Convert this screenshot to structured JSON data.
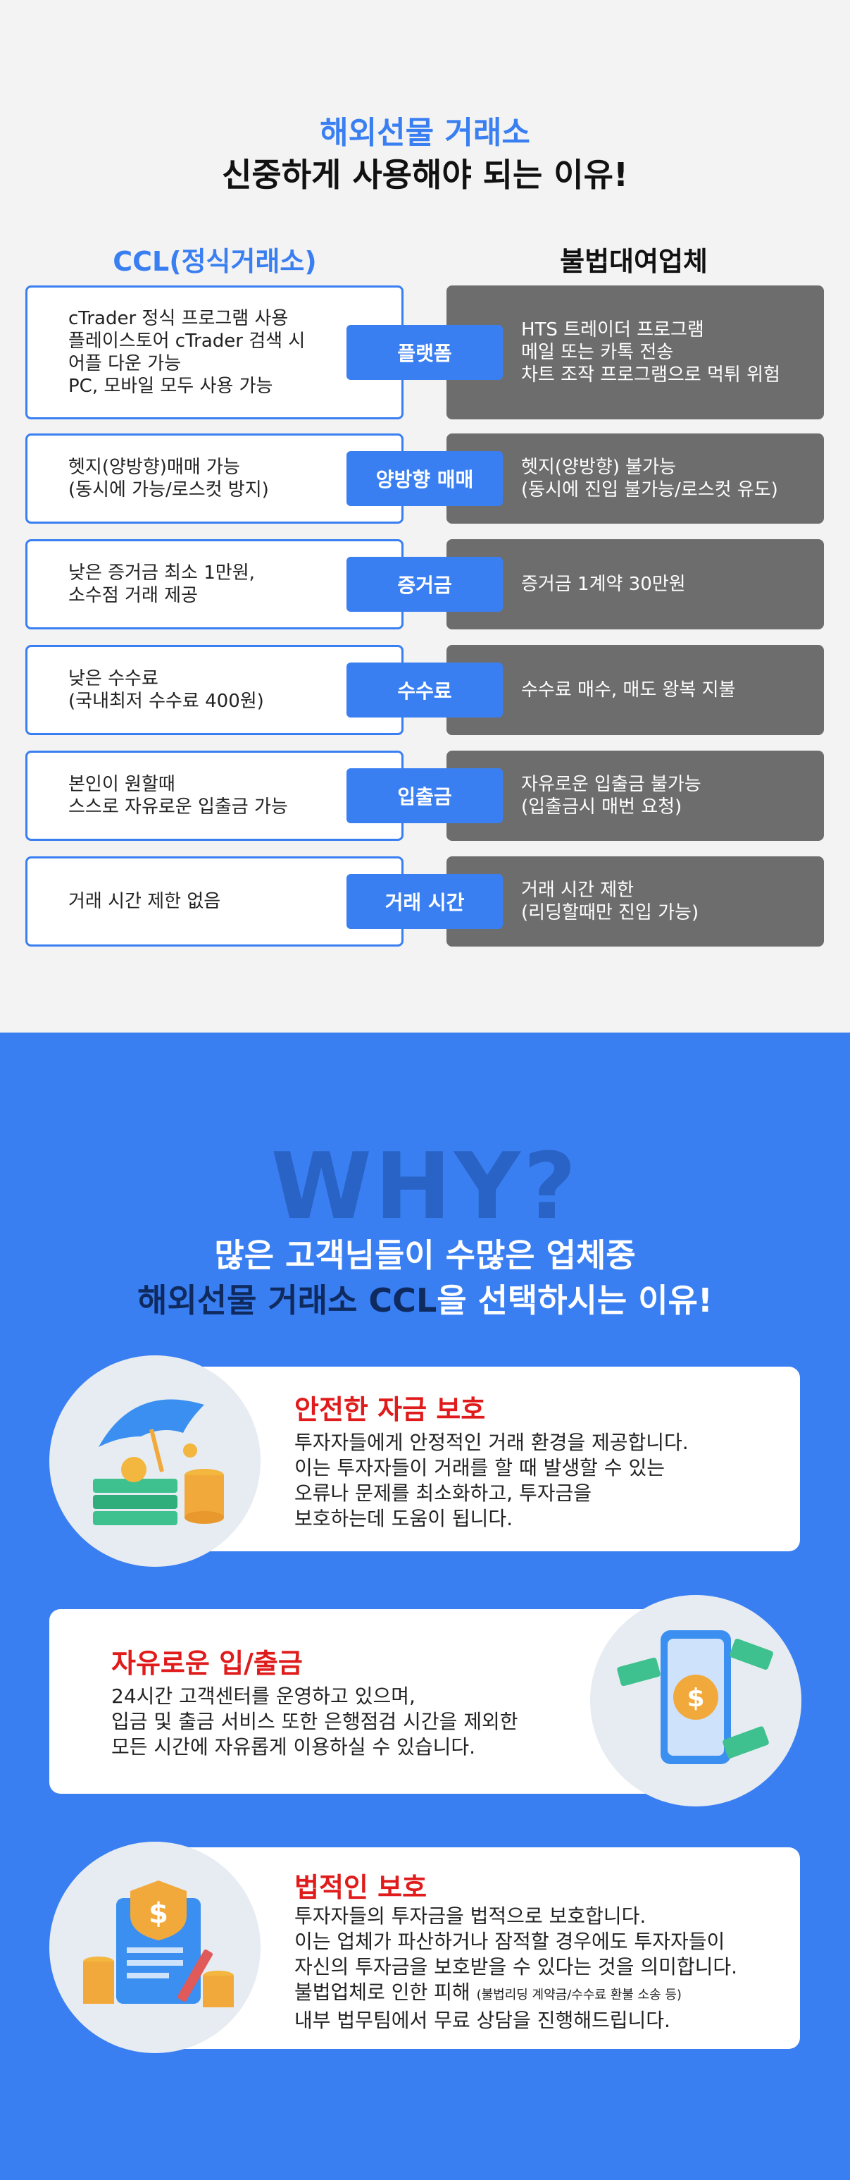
{
  "section1": {
    "title_line1": "해외선물 거래소",
    "title_line2": "신중하게 사용해야 되는 이유!",
    "left_header": "CCL(정식거래소)",
    "right_header": "불법대여업체",
    "rows": [
      {
        "label": "플랫폼",
        "left": "cTrader 정식 프로그램 사용\n플레이스토어 cTrader 검색 시\n어플 다운 가능\nPC, 모바일 모두 사용 가능",
        "right": "HTS 트레이더 프로그램\n메일 또는 카톡 전송\n차트 조작 프로그램으로 먹튀 위험"
      },
      {
        "label": "양방향 매매",
        "left": "헷지(양방향)매매 가능\n(동시에 가능/로스컷 방지)",
        "right": "헷지(양방향) 불가능\n(동시에 진입 불가능/로스컷 유도)"
      },
      {
        "label": "증거금",
        "left": "낮은 증거금 최소 1만원,\n소수점 거래 제공",
        "right": "증거금 1계약 30만원"
      },
      {
        "label": "수수료",
        "left": "낮은 수수료\n(국내최저 수수료 400원)",
        "right": "수수료 매수, 매도 왕복 지불"
      },
      {
        "label": "입출금",
        "left": "본인이 원할때\n스스로 자유로운 입출금 가능",
        "right": "자유로운 입출금 불가능\n(입출금시 매번 요청)"
      },
      {
        "label": "거래 시간",
        "left": "거래 시간 제한 없음",
        "right": "거래 시간 제한\n(리딩할때만 진입 가능)"
      }
    ]
  },
  "section2": {
    "watermark": "WHY?",
    "title_line1": "많은 고객님들이 수많은 업체중",
    "title_line2_accent": "해외선물 거래소 CCL",
    "title_line2_rest": "을 선택하시는 이유!",
    "cards": [
      {
        "title": "안전한 자금 보호",
        "body": "투자자들에게 안정적인 거래 환경을 제공합니다.\n이는 투자자들이 거래를 할 때 발생할 수 있는\n오류나 문제를 최소화하고, 투자금을\n보호하는데 도움이 됩니다.",
        "icon": "umbrella-money-icon"
      },
      {
        "title": "자유로운 입/출금",
        "body": "24시간 고객센터를 운영하고 있으며,\n입금 및 출금 서비스 또한 은행점검 시간을 제외한\n모든 시간에 자유롭게 이용하실 수 있습니다.",
        "icon": "phone-coin-icon"
      },
      {
        "title": "법적인 보호",
        "body_lines": [
          "투자자들의 투자금을 법적으로 보호합니다.",
          "이는 업체가 파산하거나 잠적할 경우에도 투자자들이",
          "자신의 투자금을 보호받을 수 있다는 것을 의미합니다."
        ],
        "body_line4_main": "불법업체로 인한 피해",
        "body_line4_small": "(불법리딩 계약금/수수료 환불 소송 등)",
        "body_line5": "내부 법무팀에서 무료 상담을 진행해드립니다.",
        "icon": "legal-document-icon"
      }
    ]
  },
  "colors": {
    "primary_blue": "#3a7ff2",
    "dark_gray": "#6d6d6d",
    "red_title": "#e01b1b",
    "navy_accent": "#0f2a5e"
  }
}
